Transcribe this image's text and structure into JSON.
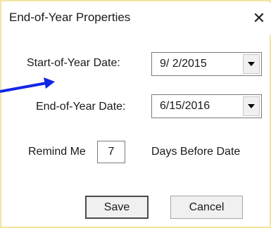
{
  "window": {
    "title": "End-of-Year Properties",
    "close_glyph": "✕"
  },
  "fields": {
    "start_label": "Start-of-Year Date:",
    "start_value": "9/ 2/2015",
    "end_label": "End-of-Year Date:",
    "end_value": "6/15/2016",
    "remind_label": "Remind Me",
    "remind_value": "7",
    "remind_suffix": "Days Before Date"
  },
  "buttons": {
    "save_label": "Save",
    "cancel_label": "Cancel"
  },
  "icons": {
    "close": "close-icon",
    "dropdown": "chevron-down-icon",
    "annotation": "arrow-icon"
  },
  "colors": {
    "frame_border": "#f1e5a4",
    "annotation_arrow": "#1226e6",
    "button_face": "#f0f0f0"
  }
}
